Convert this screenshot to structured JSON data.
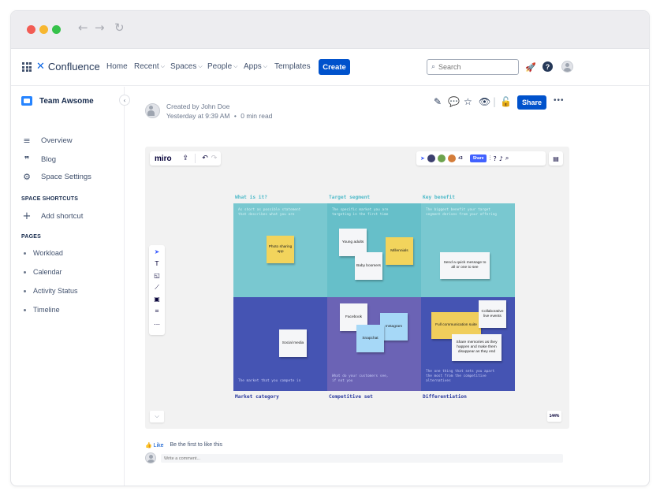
{
  "browser": {
    "back_icon": "←",
    "forward_icon": "→",
    "reload_icon": "↻"
  },
  "app": {
    "logo_text": "Confluence"
  },
  "nav": {
    "home": "Home",
    "recent": "Recent",
    "spaces": "Spaces",
    "people": "People",
    "apps": "Apps",
    "templates": "Templates",
    "create": "Create",
    "search_placeholder": "Search"
  },
  "sidebar": {
    "space_name": "Team Awsome",
    "items": [
      {
        "label": "Overview",
        "icon": "lines-icon"
      },
      {
        "label": "Blog",
        "icon": "quote-icon"
      },
      {
        "label": "Space Settings",
        "icon": "gear-icon"
      }
    ],
    "shortcuts_heading": "SPACE SHORTCUTS",
    "add_shortcut": "Add shortcut",
    "pages_heading": "PAGES",
    "pages": [
      "Workload",
      "Calendar",
      "Activity Status",
      "Timeline"
    ]
  },
  "page": {
    "created_by": "Created by John Doe",
    "timestamp": "Yesterday at 9:39 AM",
    "read_time": "0 min read",
    "share": "Share"
  },
  "miro": {
    "logo": "miro",
    "share": "Share",
    "extra_users": "+3",
    "zoom": "144%",
    "columns": [
      "What is it?",
      "Target segment",
      "Key benefit"
    ],
    "rows": [
      "Market category",
      "Competitive set",
      "Differentiation"
    ],
    "notes": {
      "c1": "As short as possible statement\nthat describes what you are",
      "c2": "The specific market you are\ntargeting in the first time",
      "c3": "The biggest benefit your target\nsegment derives from your offering",
      "c4": "The market that you compete in",
      "c5": "What do your customers see,\nif not you",
      "c6": "The one thing that sets you apart\nthe most from the competitive\nalternatives"
    },
    "stickies": {
      "photo": "Photo sharing app",
      "young": "Young adults",
      "millennials": "Millennials",
      "boomers": "Baby boomers",
      "quick": "Send a quick message to all or one to see",
      "social": "Social media",
      "facebook": "Facebook",
      "instagram": "Instagram",
      "snapchat": "Snapchat",
      "full": "Full communication suite",
      "collab": "Collaborative live events",
      "memories": "Share memories as they happen and make them disappear as they end"
    },
    "colors": {
      "teal": "#79c8d0",
      "teal_mid": "#66bfc9",
      "indigo": "#4554b3",
      "indigo_mid": "#6b63b5"
    }
  },
  "footer": {
    "like": "Like",
    "like_hint": "Be the first to like this",
    "comment_placeholder": "Write a comment..."
  }
}
